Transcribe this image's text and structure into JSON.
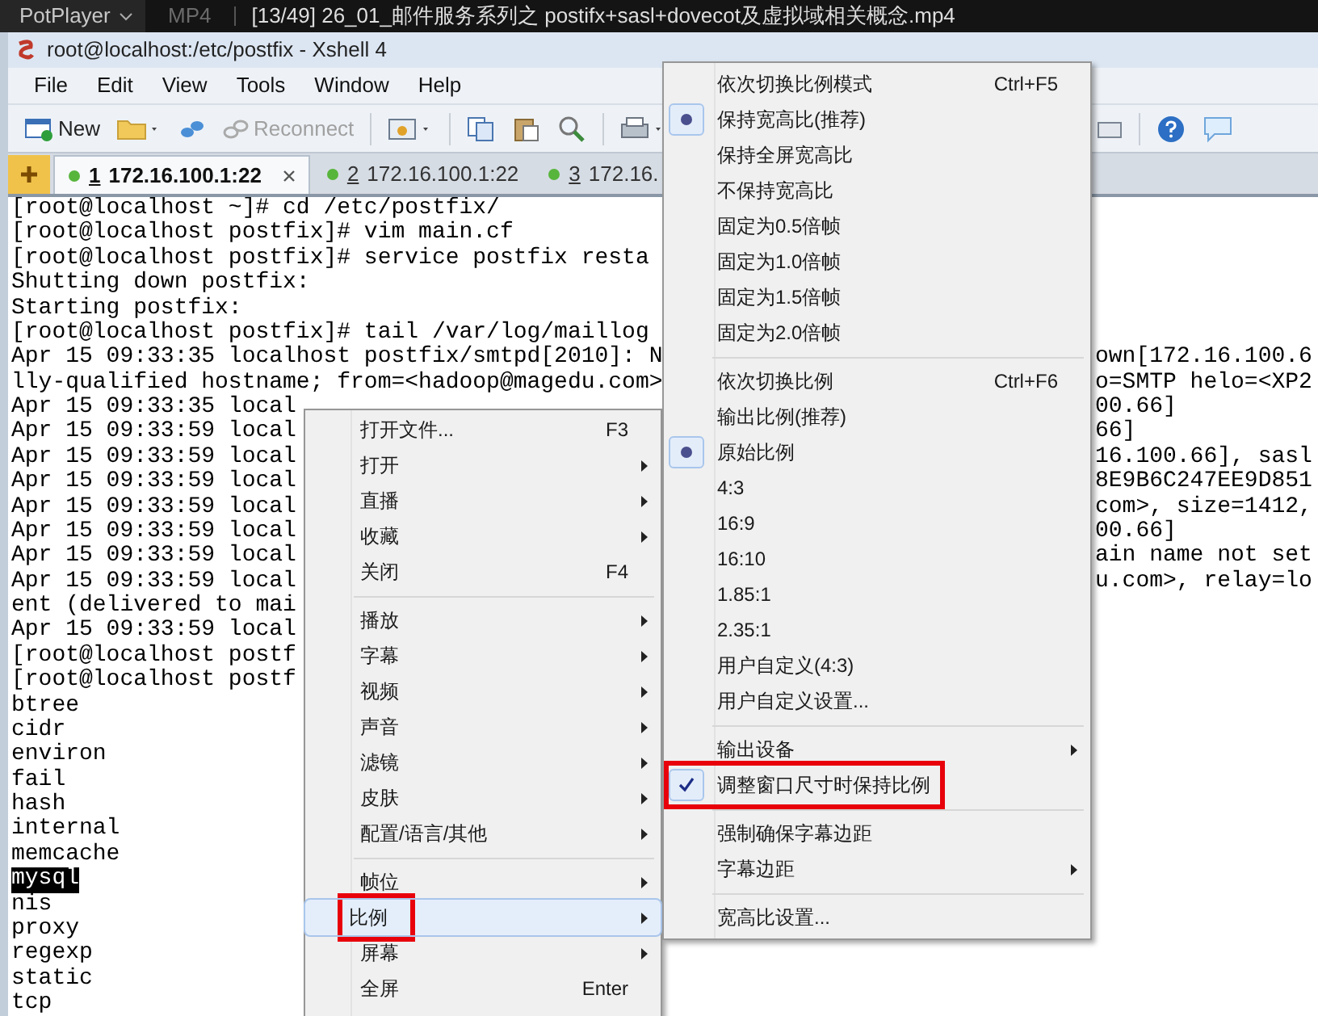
{
  "player_bar": {
    "app": "PotPlayer",
    "format": "MP4",
    "title": "[13/49] 26_01_邮件服务系列之 postifx+sasl+dovecot及虚拟域相关概念.mp4"
  },
  "window": {
    "title": "root@localhost:/etc/postfix - Xshell 4"
  },
  "menubar": [
    "File",
    "Edit",
    "View",
    "Tools",
    "Window",
    "Help"
  ],
  "toolbar": {
    "new_button": {
      "label": "New"
    },
    "reconnect_button": {
      "label": "Reconnect",
      "disabled": true
    }
  },
  "tabs": [
    {
      "number": "1",
      "address": "172.16.100.1:22",
      "selected": true
    },
    {
      "number": "2",
      "address": "172.16.100.1:22",
      "selected": false
    },
    {
      "number": "3",
      "address": "172.16.",
      "selected": false
    }
  ],
  "terminal": {
    "lines": [
      {
        "text": "[root@localhost ~]# cd /etc/postfix/",
        "highlighted": false
      },
      {
        "text": "[root@localhost postfix]# vim main.cf",
        "highlighted": false
      },
      {
        "text": "[root@localhost postfix]# service postfix resta",
        "highlighted": false
      },
      {
        "text": "Shutting down postfix:",
        "highlighted": false
      },
      {
        "text": "Starting postfix:",
        "highlighted": false
      },
      {
        "text": "[root@localhost postfix]# tail /var/log/maillog",
        "highlighted": false
      },
      {
        "text": "Apr 15 09:33:35 localhost postfix/smtpd[2010]: N",
        "tail": "own[172.16.100.6",
        "highlighted": false
      },
      {
        "text": "lly-qualified hostname; from=<hadoop@magedu.com>",
        "tail": "o=SMTP helo=<XP2",
        "highlighted": false
      },
      {
        "text": "Apr 15 09:33:35 local",
        "tail": "00.66]",
        "highlighted": false
      },
      {
        "text": "Apr 15 09:33:59 local",
        "tail": "66]",
        "highlighted": false
      },
      {
        "text": "Apr 15 09:33:59 local",
        "tail": "16.100.66], sasl",
        "highlighted": false
      },
      {
        "text": "Apr 15 09:33:59 local",
        "tail": "8E9B6C247EE9D851",
        "highlighted": false
      },
      {
        "text": "Apr 15 09:33:59 local",
        "tail": "com>, size=1412,",
        "highlighted": false
      },
      {
        "text": "Apr 15 09:33:59 local",
        "tail": "00.66]",
        "highlighted": false
      },
      {
        "text": "Apr 15 09:33:59 local",
        "tail": "ain name not set",
        "highlighted": false
      },
      {
        "text": "Apr 15 09:33:59 local",
        "tail": "u.com>, relay=lo",
        "highlighted": false
      },
      {
        "text": "ent (delivered to mai",
        "highlighted": false
      },
      {
        "text": "Apr 15 09:33:59 local",
        "highlighted": false
      },
      {
        "text": "[root@localhost postf",
        "highlighted": false
      },
      {
        "text": "[root@localhost postf",
        "highlighted": false
      },
      {
        "text": "btree",
        "highlighted": false
      },
      {
        "text": "cidr",
        "highlighted": false
      },
      {
        "text": "environ",
        "highlighted": false
      },
      {
        "text": "fail",
        "highlighted": false
      },
      {
        "text": "hash",
        "highlighted": false
      },
      {
        "text": "internal",
        "highlighted": false
      },
      {
        "text": "memcache",
        "highlighted": false
      },
      {
        "text": "mysql",
        "highlighted": true
      },
      {
        "text": "nis",
        "highlighted": false
      },
      {
        "text": "proxy",
        "highlighted": false
      },
      {
        "text": "regexp",
        "highlighted": false
      },
      {
        "text": "static",
        "highlighted": false
      },
      {
        "text": "tcp",
        "highlighted": false
      }
    ]
  },
  "context_menu": {
    "items": [
      {
        "kind": "item",
        "label": "打开文件...",
        "shortcut": "F3",
        "submenu": false,
        "selected": false,
        "annotated": false
      },
      {
        "kind": "item",
        "label": "打开",
        "submenu": true,
        "selected": false,
        "annotated": false
      },
      {
        "kind": "item",
        "label": "直播",
        "submenu": true,
        "selected": false,
        "annotated": false
      },
      {
        "kind": "item",
        "label": "收藏",
        "submenu": true,
        "selected": false,
        "annotated": false
      },
      {
        "kind": "item",
        "label": "关闭",
        "shortcut": "F4",
        "submenu": false,
        "selected": false,
        "annotated": false
      },
      {
        "kind": "separator"
      },
      {
        "kind": "item",
        "label": "播放",
        "submenu": true,
        "selected": false,
        "annotated": false
      },
      {
        "kind": "item",
        "label": "字幕",
        "submenu": true,
        "selected": false,
        "annotated": false
      },
      {
        "kind": "item",
        "label": "视频",
        "submenu": true,
        "selected": false,
        "annotated": false
      },
      {
        "kind": "item",
        "label": "声音",
        "submenu": true,
        "selected": false,
        "annotated": false
      },
      {
        "kind": "item",
        "label": "滤镜",
        "submenu": true,
        "selected": false,
        "annotated": false
      },
      {
        "kind": "item",
        "label": "皮肤",
        "submenu": true,
        "selected": false,
        "annotated": false
      },
      {
        "kind": "item",
        "label": "配置/语言/其他",
        "submenu": true,
        "selected": false,
        "annotated": false
      },
      {
        "kind": "separator"
      },
      {
        "kind": "item",
        "label": "帧位",
        "submenu": true,
        "selected": false,
        "annotated": false
      },
      {
        "kind": "item",
        "label": "比例",
        "submenu": true,
        "selected": true,
        "annotated": true
      },
      {
        "kind": "item",
        "label": "屏幕",
        "submenu": true,
        "selected": false,
        "annotated": false
      },
      {
        "kind": "item",
        "label": "全屏",
        "shortcut": "Enter",
        "submenu": false,
        "selected": false,
        "annotated": false
      }
    ]
  },
  "ratio_submenu": {
    "items": [
      {
        "kind": "item",
        "label": "依次切换比例模式",
        "shortcut": "Ctrl+F5",
        "submenu": false,
        "checked": false,
        "annotated": false
      },
      {
        "kind": "radio",
        "label": "保持宽高比(推荐)",
        "submenu": false,
        "checked": true,
        "annotated": false
      },
      {
        "kind": "item",
        "label": "保持全屏宽高比",
        "submenu": false,
        "checked": false,
        "annotated": false
      },
      {
        "kind": "item",
        "label": "不保持宽高比",
        "submenu": false,
        "checked": false,
        "annotated": false
      },
      {
        "kind": "item",
        "label": "固定为0.5倍帧",
        "submenu": false,
        "checked": false,
        "annotated": false
      },
      {
        "kind": "item",
        "label": "固定为1.0倍帧",
        "submenu": false,
        "checked": false,
        "annotated": false
      },
      {
        "kind": "item",
        "label": "固定为1.5倍帧",
        "submenu": false,
        "checked": false,
        "annotated": false
      },
      {
        "kind": "item",
        "label": "固定为2.0倍帧",
        "submenu": false,
        "checked": false,
        "annotated": false
      },
      {
        "kind": "separator"
      },
      {
        "kind": "item",
        "label": "依次切换比例",
        "shortcut": "Ctrl+F6",
        "submenu": false,
        "checked": false,
        "annotated": false
      },
      {
        "kind": "item",
        "label": "输出比例(推荐)",
        "submenu": false,
        "checked": false,
        "annotated": false
      },
      {
        "kind": "radio",
        "label": "原始比例",
        "submenu": false,
        "checked": true,
        "annotated": false
      },
      {
        "kind": "item",
        "label": "4:3",
        "submenu": false,
        "checked": false,
        "annotated": false
      },
      {
        "kind": "item",
        "label": "16:9",
        "submenu": false,
        "checked": false,
        "annotated": false
      },
      {
        "kind": "item",
        "label": "16:10",
        "submenu": false,
        "checked": false,
        "annotated": false
      },
      {
        "kind": "item",
        "label": "1.85:1",
        "submenu": false,
        "checked": false,
        "annotated": false
      },
      {
        "kind": "item",
        "label": "2.35:1",
        "submenu": false,
        "checked": false,
        "annotated": false
      },
      {
        "kind": "item",
        "label": "用户自定义(4:3)",
        "submenu": false,
        "checked": false,
        "annotated": false
      },
      {
        "kind": "item",
        "label": "用户自定义设置...",
        "submenu": false,
        "checked": false,
        "annotated": false
      },
      {
        "kind": "separator"
      },
      {
        "kind": "item",
        "label": "输出设备",
        "submenu": true,
        "checked": false,
        "annotated": false
      },
      {
        "kind": "check",
        "label": "调整窗口尺寸时保持比例",
        "submenu": false,
        "checked": true,
        "annotated": true
      },
      {
        "kind": "separator"
      },
      {
        "kind": "item",
        "label": "强制确保字幕边距",
        "submenu": false,
        "checked": false,
        "annotated": false
      },
      {
        "kind": "item",
        "label": "字幕边距",
        "submenu": true,
        "checked": false,
        "annotated": false
      },
      {
        "kind": "separator"
      },
      {
        "kind": "item",
        "label": "宽高比设置...",
        "submenu": false,
        "checked": false,
        "annotated": false
      }
    ]
  }
}
